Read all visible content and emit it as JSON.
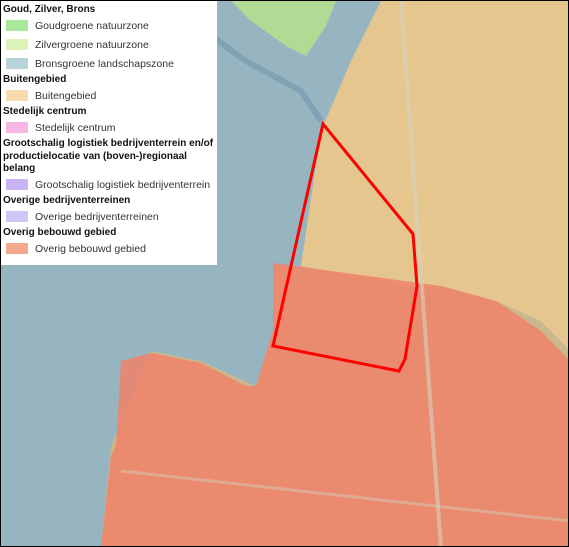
{
  "legend": {
    "groups": [
      {
        "heading": "Goud, Zilver, Brons",
        "items": [
          {
            "label": "Goudgroene natuurzone",
            "color": "#a9e79b"
          },
          {
            "label": "Zilvergroene natuurzone",
            "color": "#ddf3b9"
          },
          {
            "label": "Bronsgroene landschapszone",
            "color": "#b9d4d9"
          }
        ]
      },
      {
        "heading": "Buitengebied",
        "items": [
          {
            "label": "Buitengebied",
            "color": "#f7dcae"
          }
        ]
      },
      {
        "heading": "Stedelijk centrum",
        "items": [
          {
            "label": "Stedelijk centrum",
            "color": "#f7b6e3"
          }
        ]
      },
      {
        "heading_lines": [
          "Grootschalig logistiek bedrijventerrein en/of",
          "productielocatie van (boven-)regionaal belang"
        ],
        "items": [
          {
            "label": "Grootschalig logistiek bedrijventerrein",
            "color": "#c9b4f5"
          }
        ]
      },
      {
        "heading": "Overige bedrijventerreinen",
        "items": [
          {
            "label": "Overige bedrijventerreinen",
            "color": "#d1c4f7"
          }
        ]
      },
      {
        "heading": "Overig bebouwd gebied",
        "items": [
          {
            "label": "Overig bebouwd gebied",
            "color": "#f3a98b"
          }
        ]
      }
    ]
  },
  "map": {
    "colors": {
      "outline": "#ff0000",
      "landschapszone": "#8db5c9",
      "buitengebied": "#e9c98e",
      "bebouwd": "#f0826a",
      "goudgroen": "#b6e08c",
      "ground": "#c9b78d"
    }
  }
}
